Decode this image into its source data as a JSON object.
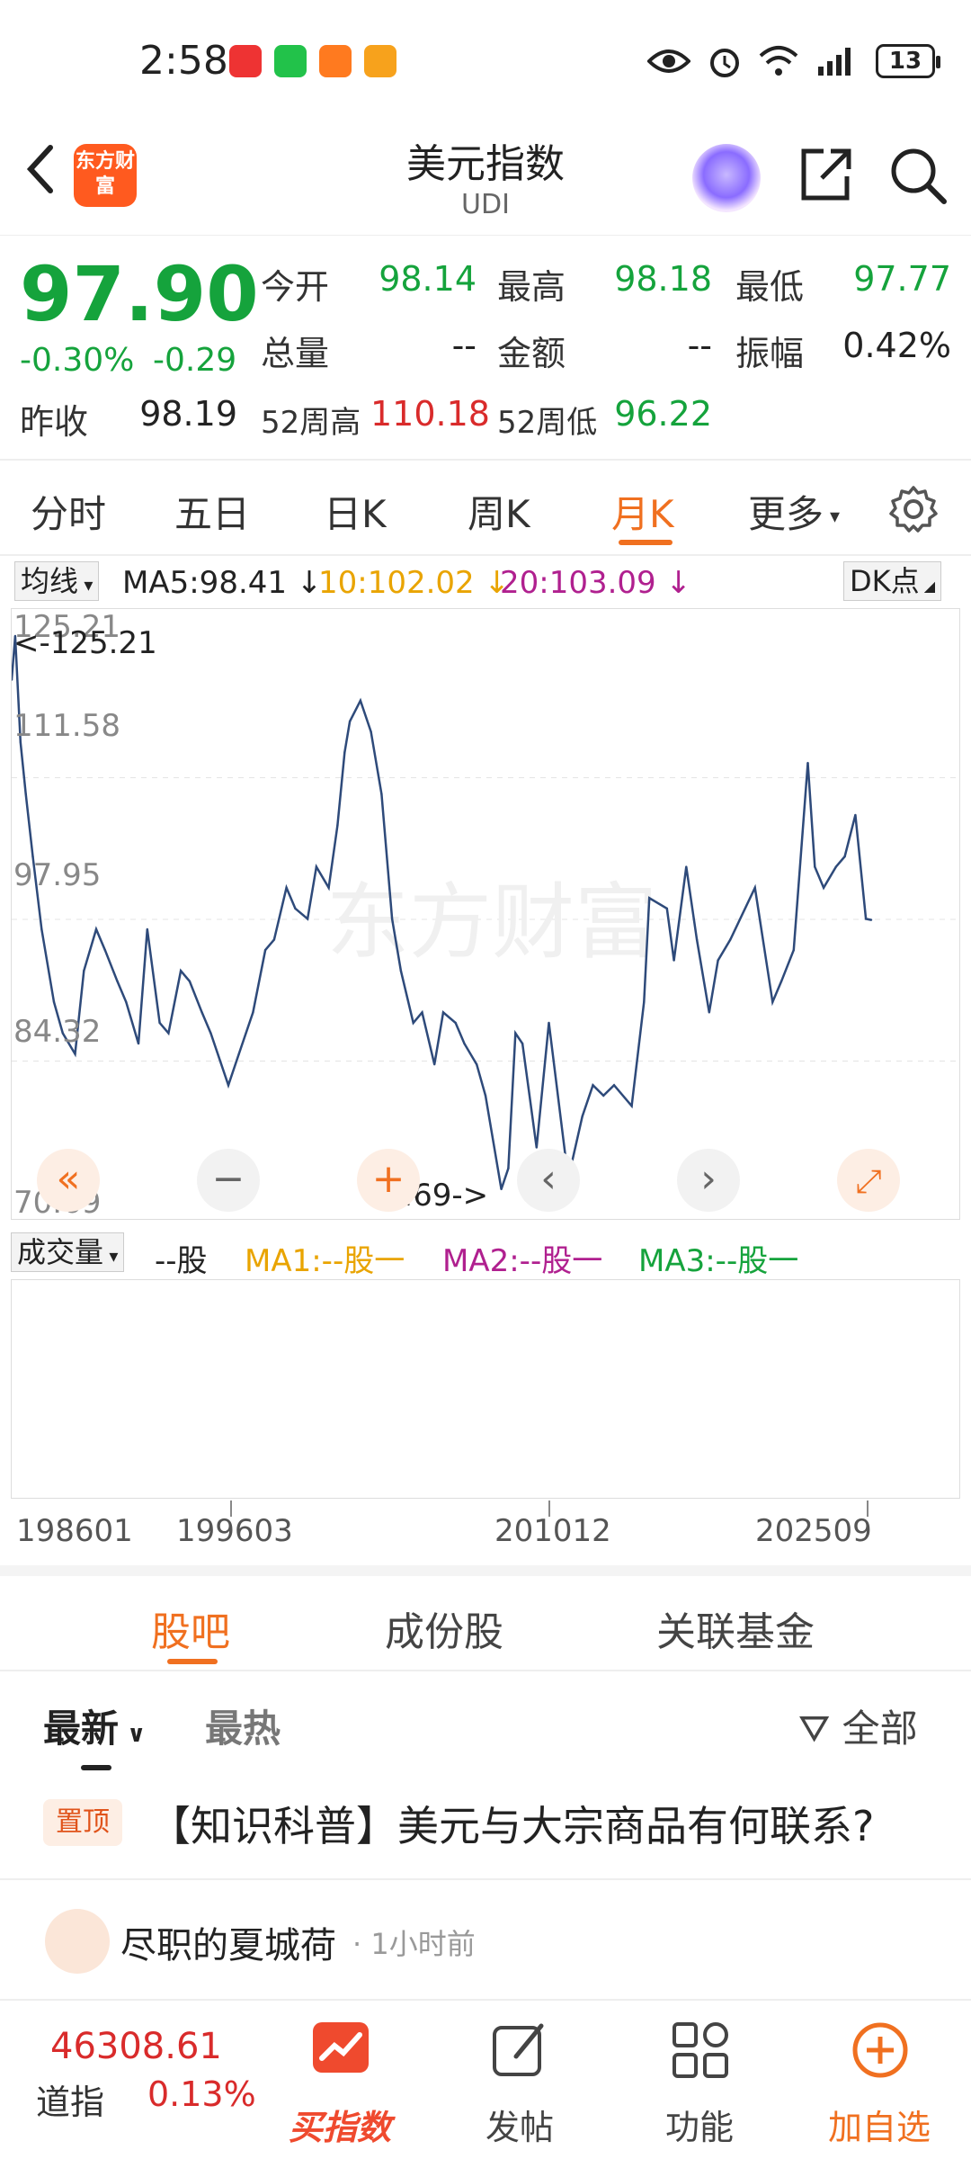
{
  "status": {
    "time": "2:58",
    "battery": "13"
  },
  "header": {
    "title": "美元指数",
    "subtitle": "UDI",
    "logo_text": "东方财富"
  },
  "quote": {
    "price": "97.90",
    "change_pct": "-0.30%",
    "change": "-0.29",
    "open_label": "今开",
    "open": "98.14",
    "high_label": "最高",
    "high": "98.18",
    "low_label": "最低",
    "low": "97.77",
    "volume_label": "总量",
    "volume": "--",
    "amount_label": "金额",
    "amount": "--",
    "amplitude_label": "振幅",
    "amplitude": "0.42%",
    "prev_label": "昨收",
    "prev": "98.19",
    "wk52_high_label": "52周高",
    "wk52_high": "110.18",
    "wk52_low_label": "52周低",
    "wk52_low": "96.22"
  },
  "chart_tabs": [
    "分时",
    "五日",
    "日K",
    "周K",
    "月K",
    "更多"
  ],
  "active_chart_tab": "月K",
  "ma": {
    "selector": "均线",
    "ma5": "MA5:98.41",
    "ma10": "10:102.02",
    "ma20": "20:103.09",
    "dk": "DK点"
  },
  "chart_data": {
    "type": "line",
    "title": "",
    "y_ticks": [
      "125.21",
      "111.58",
      "97.95",
      "84.32",
      "70.69"
    ],
    "ylim": [
      70.69,
      125.21
    ],
    "max_label": "<-125.21",
    "min_label": "70.69->",
    "x_ticks": [
      "198601",
      "199603",
      "201012",
      "202509"
    ],
    "series": [
      {
        "x": [
          "1985-01",
          "1985-03",
          "1985-06",
          "1985-09",
          "1986-01",
          "1986-06",
          "1987-01",
          "1987-06",
          "1988-01",
          "1988-06",
          "1989-01",
          "1989-06",
          "1990-01",
          "1990-06",
          "1991-01",
          "1991-06",
          "1992-01",
          "1992-06",
          "1993-01",
          "1993-06",
          "1994-01",
          "1994-06",
          "1995-04",
          "1995-10",
          "1996-06",
          "1997-01",
          "1997-06",
          "1998-01",
          "1998-06",
          "1999-01",
          "1999-06",
          "2000-01",
          "2000-06",
          "2000-10",
          "2001-01",
          "2001-07",
          "2002-01",
          "2002-07",
          "2003-01",
          "2003-06",
          "2004-01",
          "2004-06",
          "2005-01",
          "2005-06",
          "2006-01",
          "2006-06",
          "2007-01",
          "2007-06",
          "2008-03",
          "2008-07",
          "2008-11",
          "2009-03",
          "2009-11",
          "2010-06",
          "2011-05",
          "2012-01",
          "2012-07",
          "2013-01",
          "2013-07",
          "2014-05",
          "2014-12",
          "2015-03",
          "2016-01",
          "2016-05",
          "2016-12",
          "2017-06",
          "2018-01",
          "2018-06",
          "2019-01",
          "2020-03",
          "2021-01",
          "2021-06",
          "2022-01",
          "2022-09",
          "2023-01",
          "2023-06",
          "2024-01",
          "2024-06",
          "2024-12",
          "2025-06",
          "2025-09"
        ],
        "y": [
          121,
          125.21,
          115,
          110,
          104,
          97,
          90,
          87,
          85,
          93,
          97,
          95,
          92,
          90,
          86,
          97,
          88,
          87,
          93,
          92,
          89,
          87,
          82,
          85,
          89,
          95,
          96,
          101,
          99,
          98,
          103,
          101,
          107,
          114,
          117,
          119,
          116,
          110,
          98,
          93,
          88,
          89,
          84,
          89,
          88,
          86,
          84,
          81,
          72,
          74,
          87,
          86,
          76,
          88,
          73,
          79,
          82,
          81,
          82,
          80,
          90,
          100,
          99,
          94,
          103,
          96,
          89,
          94,
          96,
          101,
          90,
          92,
          95,
          113,
          103,
          101,
          103,
          104,
          108,
          98,
          97.9
        ]
      }
    ]
  },
  "vol": {
    "selector": "成交量",
    "unit": "--股",
    "ma1": "MA1:--股一",
    "ma2": "MA2:--股一",
    "ma3": "MA3:--股一"
  },
  "bottom_tabs": [
    "股吧",
    "成份股",
    "关联基金"
  ],
  "sort": {
    "latest": "最新",
    "hot": "最热",
    "filter": "全部"
  },
  "pinned": {
    "badge": "置顶",
    "title": "【知识科普】美元与大宗商品有何联系?"
  },
  "post": {
    "user": "尽职的夏城荷",
    "time": "· 1小时前"
  },
  "bottombar": {
    "index_value": "46308.61",
    "index_name": "道指",
    "index_pct": "0.13%",
    "items": [
      "买指数",
      "发帖",
      "功能",
      "加自选"
    ]
  },
  "colors": {
    "up": "#d92b2b",
    "down": "#15a33c",
    "accent": "#f07020",
    "line": "#2e4a7a"
  }
}
